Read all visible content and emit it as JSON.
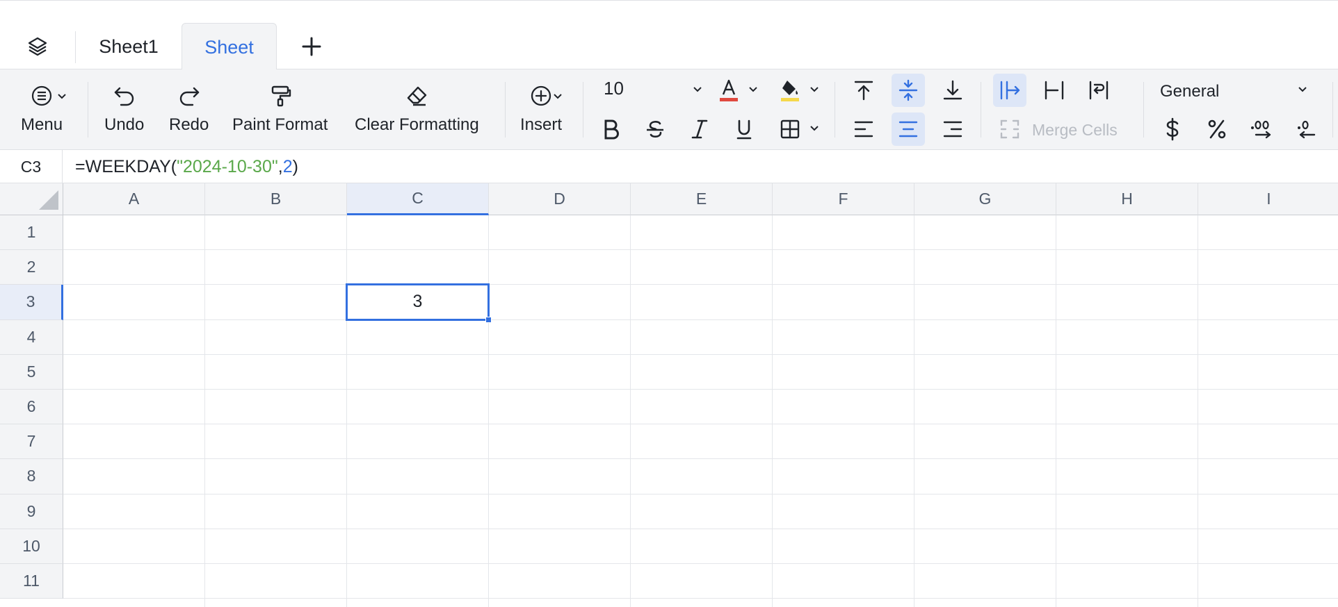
{
  "tabs": {
    "items": [
      {
        "label": "Sheet1",
        "active": false
      },
      {
        "label": "Sheet",
        "active": true
      }
    ]
  },
  "toolbar": {
    "menu_label": "Menu",
    "undo_label": "Undo",
    "redo_label": "Redo",
    "paint_format_label": "Paint Format",
    "clear_formatting_label": "Clear Formatting",
    "insert_label": "Insert",
    "font_size": "10",
    "number_format": "General",
    "merge_cells_label": "Merge Cells",
    "text_color": "#e0493f",
    "fill_color": "#f5d84b"
  },
  "formula_bar": {
    "cell_ref": "C3",
    "formula_prefix": "=WEEKDAY(",
    "formula_string": "\"2024-10-30\"",
    "formula_comma": ",",
    "formula_number": "2",
    "formula_suffix": ")"
  },
  "grid": {
    "columns": [
      "A",
      "B",
      "C",
      "D",
      "E",
      "F",
      "G",
      "H",
      "I"
    ],
    "rows": [
      "1",
      "2",
      "3",
      "4",
      "5",
      "6",
      "7",
      "8",
      "9",
      "10",
      "11"
    ],
    "selected_column": "C",
    "selected_row": "3",
    "selected_cell_value": "3"
  },
  "colors": {
    "accent": "#3370e0",
    "formula_string": "#5aa84a"
  }
}
